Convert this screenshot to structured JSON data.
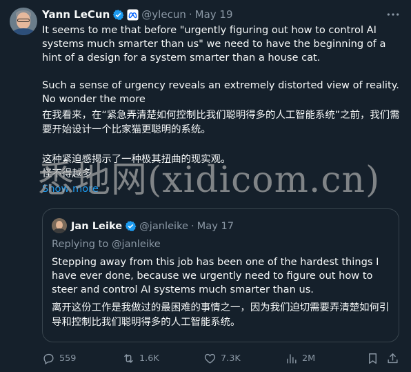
{
  "tweet": {
    "author_name": "Yann LeCun",
    "handle": "@ylecun",
    "separator": "·",
    "date": "May 19",
    "paragraphs_en": [
      "It seems to me that before \"urgently figuring out how to control AI systems much smarter than us\" we need to have the beginning of a hint of a design for a system smarter than a house cat.",
      "Such a sense of urgency reveals an extremely distorted view of reality.\nNo wonder the more"
    ],
    "paragraphs_zh": [
      "在我看来，在“紧急弄清楚如何控制比我们聪明得多的人工智能系统”之前，我们需要开始设计一个比家猫更聪明的系统。",
      "这种紧迫感揭示了一种极其扭曲的现实观。\n怪不得越多"
    ],
    "show_more": "Show more"
  },
  "quote": {
    "author_name": "Jan Leike",
    "handle": "@janleike",
    "separator": "·",
    "date": "May 17",
    "replying_to_prefix": "Replying to ",
    "replying_to_handle": "@janleike",
    "text_en": "Stepping away from this job has been one of the hardest things I have ever done, because we urgently need to figure out how to steer and control AI systems much smarter than us.",
    "text_zh": "离开这份工作是我做过的最困难的事情之一，因为我们迫切需要弄清楚如何引导和控制比我们聪明得多的人工智能系统。"
  },
  "actions": {
    "replies": "559",
    "reposts": "1.6K",
    "likes": "7.3K",
    "views": "2M"
  },
  "watermark": "悉地网(xidicom.cn)",
  "icons": {
    "verified": "verified-badge-icon",
    "affiliation": "meta-affiliation-icon",
    "more": "more-dots-icon",
    "reply": "reply-icon",
    "repost": "repost-icon",
    "like": "heart-icon",
    "views": "views-chart-icon",
    "bookmark": "bookmark-icon",
    "share": "share-icon"
  },
  "colors": {
    "background": "#15202b",
    "text": "#f7f9f9",
    "muted": "#8b98a5",
    "accent": "#1d9bf0",
    "border": "#38444d"
  }
}
